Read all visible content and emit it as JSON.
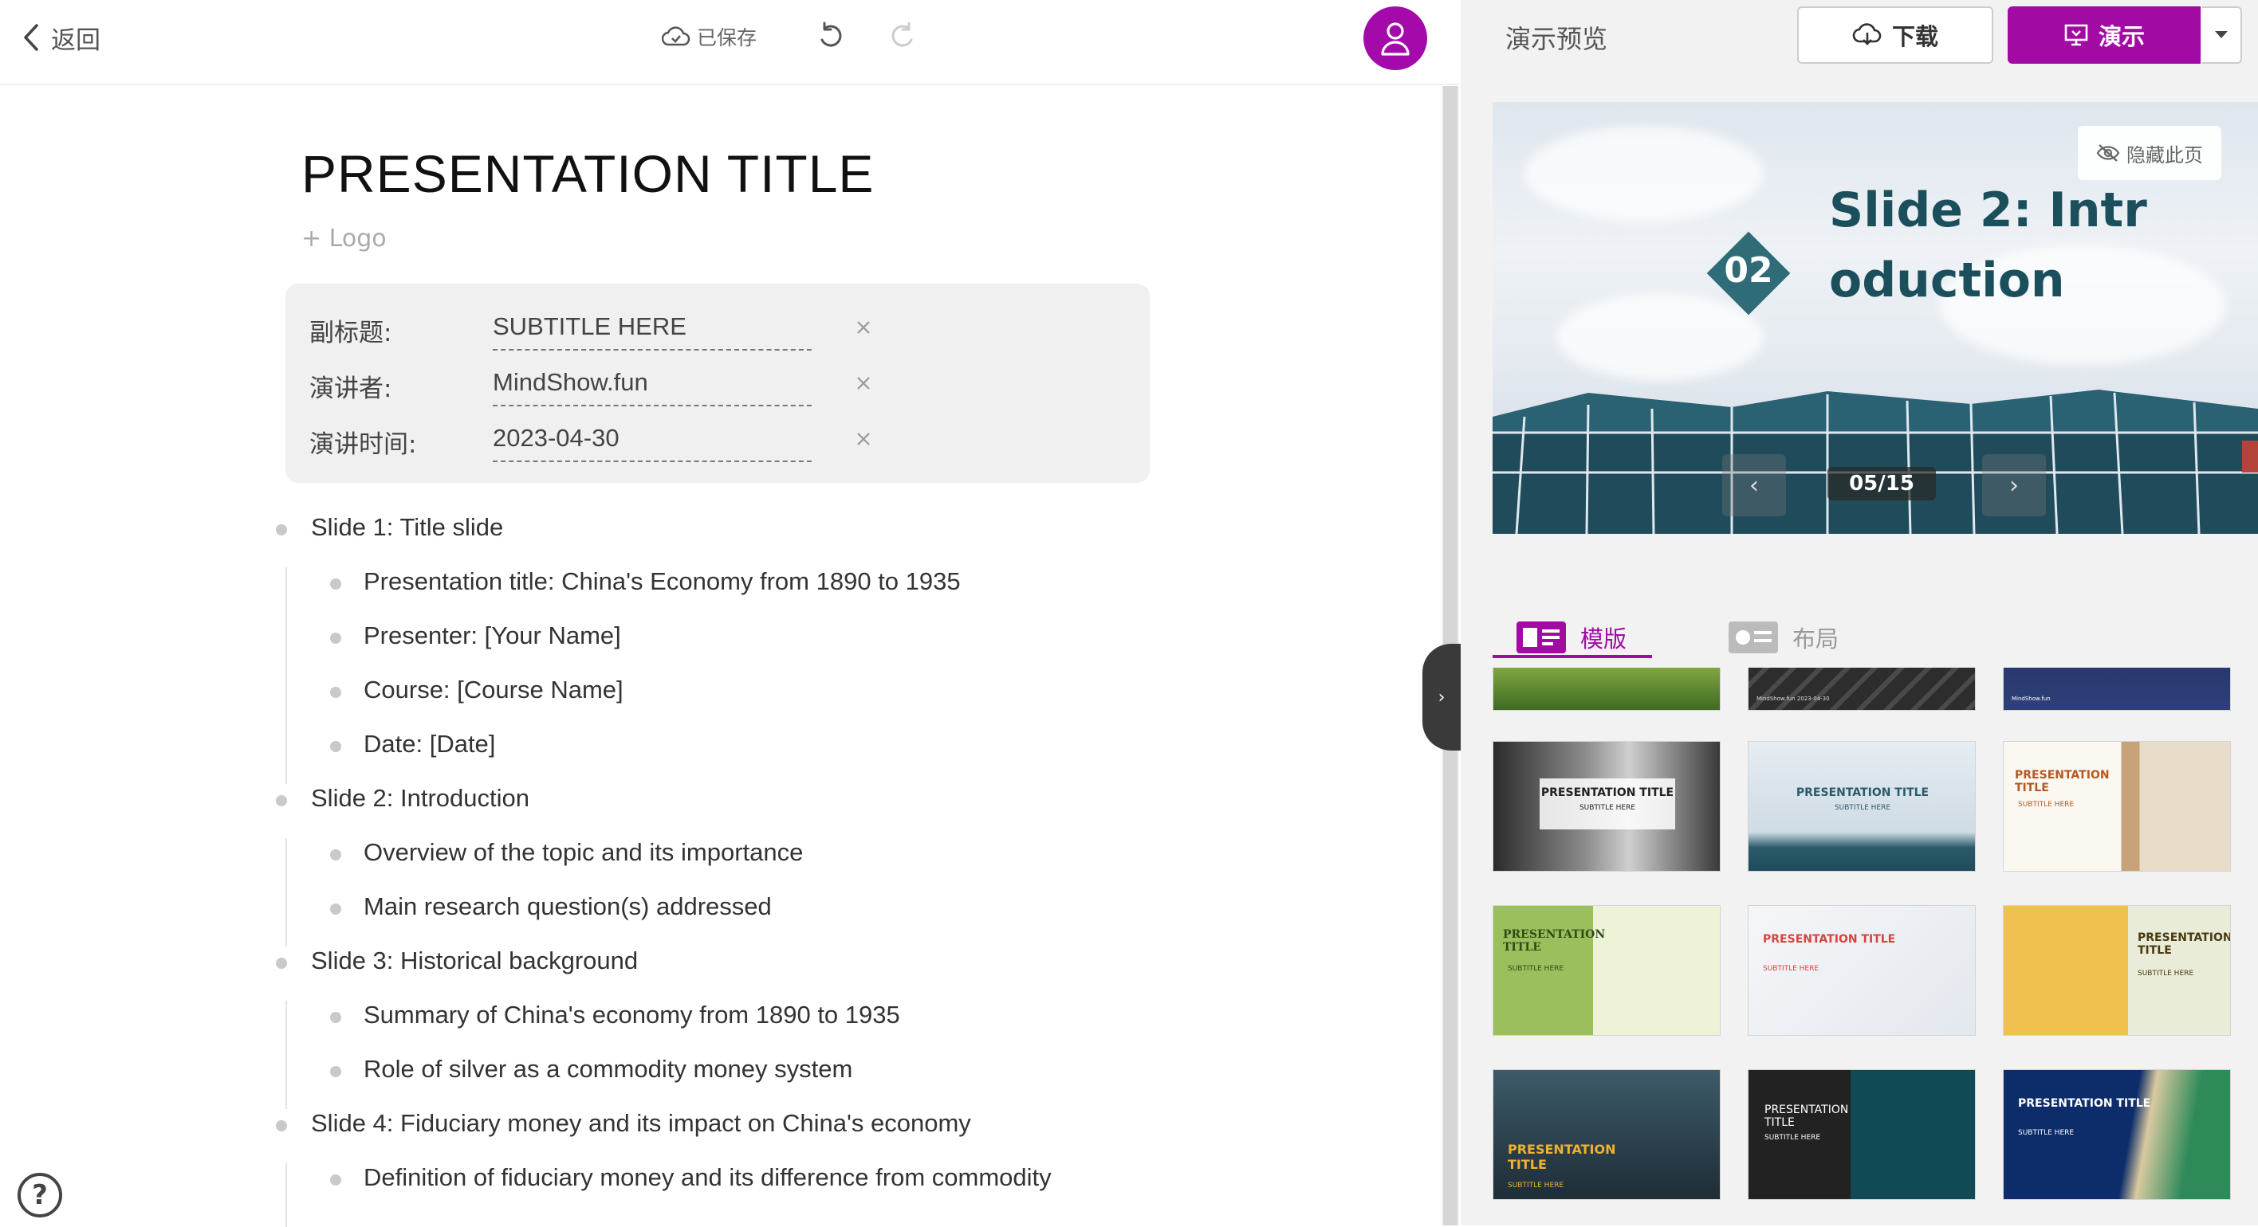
{
  "topbar": {
    "back_label": "返回",
    "save_status": "已保存",
    "icons": {
      "back": "chevron-left-icon",
      "save": "cloud-check-icon",
      "undo": "undo-icon",
      "redo": "redo-icon",
      "avatar": "user-icon"
    },
    "accent_color": "#a10ba4"
  },
  "document": {
    "title": "PRESENTATION TITLE",
    "add_logo": "+ Logo",
    "meta": [
      {
        "label": "副标题:",
        "value": "SUBTITLE HERE"
      },
      {
        "label": "演讲者:",
        "value": "MindShow.fun"
      },
      {
        "label": "演讲时间:",
        "value": "2023-04-30"
      }
    ],
    "outline": [
      {
        "level": 0,
        "text": "Slide 1: Title slide"
      },
      {
        "level": 1,
        "text": "Presentation title: China's Economy from 1890 to 1935"
      },
      {
        "level": 1,
        "text": "Presenter: [Your Name]"
      },
      {
        "level": 1,
        "text": "Course: [Course Name]"
      },
      {
        "level": 1,
        "text": "Date: [Date]"
      },
      {
        "level": 0,
        "text": "Slide 2: Introduction"
      },
      {
        "level": 1,
        "text": "Overview of the topic and its importance"
      },
      {
        "level": 1,
        "text": "Main research question(s) addressed"
      },
      {
        "level": 0,
        "text": "Slide 3: Historical background"
      },
      {
        "level": 1,
        "text": "Summary of China's economy from 1890 to 1935"
      },
      {
        "level": 1,
        "text": "Role of silver as a commodity money system"
      },
      {
        "level": 0,
        "text": "Slide 4: Fiduciary money and its impact on China's economy"
      },
      {
        "level": 1,
        "text": "Definition of fiduciary money and its difference from commodity"
      }
    ]
  },
  "help": {
    "label": "?"
  },
  "collapse_handle": {
    "label": "›"
  },
  "preview": {
    "label": "演示预览",
    "download_label": "下载",
    "present_label": "演示",
    "hide_page_label": "隐藏此页",
    "slide_number": "02",
    "slide_heading": "Slide 2: Introduction",
    "page_indicator": "05/15",
    "prev_label": "‹",
    "next_label": "›"
  },
  "tabs": [
    {
      "label": "模版",
      "active": true
    },
    {
      "label": "布局",
      "active": false
    }
  ],
  "templates": [
    {
      "title": "",
      "sub": "",
      "style": "green-field-partial"
    },
    {
      "title": "",
      "sub": "MindShow.fun  2023-04-30",
      "style": "dark-arrows-partial"
    },
    {
      "title": "",
      "sub": "MindShow.fun",
      "style": "city-night-partial"
    },
    {
      "title": "PRESENTATION TITLE",
      "sub": "SUBTITLE HERE",
      "style": "gray-forest"
    },
    {
      "title": "PRESENTATION TITLE",
      "sub": "SUBTITLE HERE",
      "style": "sky-building"
    },
    {
      "title": "PRESENTATION TITLE",
      "sub": "SUBTITLE HERE",
      "style": "cathedral"
    },
    {
      "title": "PRESENTATION TITLE",
      "sub": "SUBTITLE HERE",
      "style": "green-park"
    },
    {
      "title": "PRESENTATION TITLE",
      "sub": "SUBTITLE HERE",
      "style": "medical"
    },
    {
      "title": "PRESENTATION TITLE",
      "sub": "SUBTITLE HERE",
      "style": "yellow-blocks"
    },
    {
      "title": "PRESENTATION TITLE",
      "sub": "SUBTITLE HERE",
      "style": "sport-dark"
    },
    {
      "title": "PRESENTATION TITLE",
      "sub": "SUBTITLE HERE",
      "style": "dark-ocean"
    },
    {
      "title": "PRESENTATION TITLE",
      "sub": "SUBTITLE HERE",
      "style": "aerial-beach"
    }
  ]
}
